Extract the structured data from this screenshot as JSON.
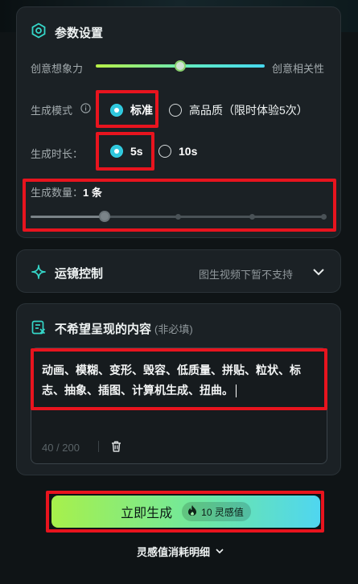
{
  "settings": {
    "title": "参数设置",
    "creativity_left": "创意想象力",
    "creativity_right": "创意相关性",
    "creativity_value": 0.56,
    "mode_label": "生成模式",
    "mode_options": [
      "标准",
      "高品质（限时体验5次）"
    ],
    "mode_selected": "标准",
    "duration_label": "生成时长：",
    "duration_options": [
      "5s",
      "10s"
    ],
    "duration_selected": "5s",
    "count_label": "生成数量：",
    "count_value": "1 条",
    "count_level": 1,
    "count_max": 5
  },
  "camera": {
    "title": "运镜控制",
    "note": "图生视频下暂不支持"
  },
  "negative": {
    "title": "不希望呈现的内容",
    "optional": "(非必填)",
    "text": "动画、模糊、变形、毁容、低质量、拼贴、粒状、标志、抽象、插图、计算机生成、扭曲。",
    "counter": "40 / 200"
  },
  "generate": {
    "label": "立即生成",
    "cost": "10 灵感值"
  },
  "footer": {
    "detail_link": "灵感值消耗明细"
  },
  "colors": {
    "accent": "#35d6e8",
    "highlight": "#e8141e"
  }
}
